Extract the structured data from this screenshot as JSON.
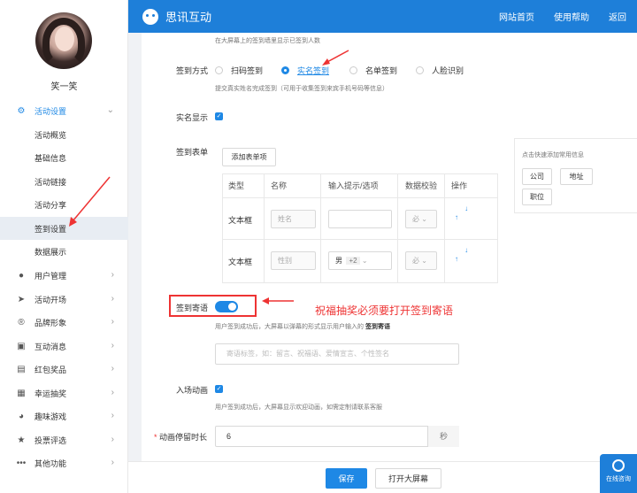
{
  "user": {
    "name": "笑一笑"
  },
  "sidebar": {
    "groups": [
      {
        "label": "活动设置",
        "icon": "gear-icon"
      },
      {
        "label": "用户管理",
        "icon": "user-icon"
      },
      {
        "label": "活动开场",
        "icon": "send-icon"
      },
      {
        "label": "品牌形象",
        "icon": "registered-icon"
      },
      {
        "label": "互动消息",
        "icon": "message-icon"
      },
      {
        "label": "红包奖品",
        "icon": "gift-icon"
      },
      {
        "label": "幸运抽奖",
        "icon": "lottery-icon"
      },
      {
        "label": "趣味游戏",
        "icon": "game-icon"
      },
      {
        "label": "投票评选",
        "icon": "star-icon"
      },
      {
        "label": "其他功能",
        "icon": "more-icon"
      }
    ],
    "sub_items": [
      "活动概览",
      "基础信息",
      "活动链接",
      "活动分享",
      "签到设置",
      "数据展示"
    ]
  },
  "header": {
    "brand": "思讯互动",
    "nav": [
      "网站首页",
      "使用帮助",
      "返回"
    ]
  },
  "form": {
    "top_hint": "在大屏幕上的签到墙里显示已签到人数",
    "signin_method_label": "签到方式",
    "signin_methods": [
      "扫码签到",
      "实名签到",
      "名单签到",
      "人脸识别"
    ],
    "selected_method": "实名签到",
    "method_hint": "提交真实姓名完成签到（可用于收集签到来宾手机号码等信息）",
    "realname_label": "实名显示",
    "form_label": "签到表单",
    "add_item_button": "添加表单项",
    "table_headers": [
      "类型",
      "名称",
      "输入提示/选项",
      "数据校验",
      "操作"
    ],
    "rows": [
      {
        "type": "文本框",
        "name": "姓名",
        "hint": "",
        "check": "必"
      },
      {
        "type": "文本框",
        "name": "性别",
        "hint": "男",
        "hint_extra": "+2",
        "check": "必"
      }
    ],
    "quick_title": "点击快速添加常用信息",
    "quick_buttons": [
      "公司",
      "地址",
      "职位"
    ],
    "message_label": "签到寄语",
    "message_hint_prefix": "用户签到成功后，大屏幕以弹幕的形式显示用户输入的",
    "message_hint_bold": "签到寄语",
    "message_placeholder": "寄语标签，如：留言、祝福语、爱情宣言、个性签名",
    "entry_anim_label": "入场动画",
    "entry_anim_hint": "用户签到成功后，大屏幕显示欢迎动画，如需定制请联系客服",
    "duration_label": "动画停留时长",
    "duration_required": "*",
    "duration_value": "6",
    "duration_unit": "秒",
    "annotation_note": "祝福抽奖必须要打开签到寄语"
  },
  "footer": {
    "save": "保存",
    "open_screen": "打开大屏幕"
  },
  "consult": {
    "label": "在线咨询"
  },
  "colors": {
    "primary": "#1e88e5",
    "header": "#1e7fd9",
    "annotation": "#e33333"
  }
}
